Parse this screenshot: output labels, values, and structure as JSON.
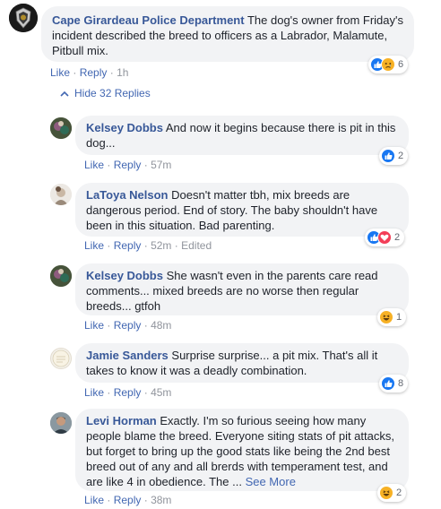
{
  "top_comment": {
    "author": "Cape Girardeau Police Department",
    "text": "The dog's owner from Friday's incident described the breed to officers as a Labrador, Malamute, Pitbull mix.",
    "like": "Like",
    "reply": "Reply",
    "time": "1h",
    "reaction_count": "6",
    "reactions": [
      "like",
      "sad"
    ]
  },
  "hide_replies": "Hide 32 Replies",
  "replies": [
    {
      "author": "Kelsey Dobbs",
      "text": "And now it begins because there is pit in this dog...",
      "like": "Like",
      "reply": "Reply",
      "time": "57m",
      "edited": "",
      "reaction_count": "2",
      "reactions": [
        "like"
      ]
    },
    {
      "author": "LaToya Nelson",
      "text": "Doesn't matter tbh, mix breeds are dangerous period. End of story. The baby shouldn't have been in this situation. Bad parenting.",
      "like": "Like",
      "reply": "Reply",
      "time": "52m",
      "edited": "Edited",
      "reaction_count": "2",
      "reactions": [
        "like",
        "love"
      ]
    },
    {
      "author": "Kelsey Dobbs",
      "text": "She wasn't even in the parents care read comments... mixed breeds are no worse then regular breeds... gtfoh",
      "like": "Like",
      "reply": "Reply",
      "time": "48m",
      "edited": "",
      "reaction_count": "1",
      "reactions": [
        "haha"
      ]
    },
    {
      "author": "Jamie Sanders",
      "text": "Surprise surprise... a pit mix. That's all it takes to know it was a deadly combination.",
      "like": "Like",
      "reply": "Reply",
      "time": "45m",
      "edited": "",
      "reaction_count": "8",
      "reactions": [
        "like"
      ]
    },
    {
      "author": "Levi Horman",
      "text": "Exactly. I'm so furious seeing how many people blame the breed. Everyone siting stats of pit attacks, but forget to bring up the good stats like being the 2nd best breed out of any and all brerds with temperament test, and are like 4 in obedience. The ...",
      "see_more": "See More",
      "like": "Like",
      "reply": "Reply",
      "time": "38m",
      "edited": "",
      "reaction_count": "2",
      "reactions": [
        "haha"
      ]
    }
  ],
  "colors": {
    "link": "#385898",
    "action": "#4267b2",
    "bubble": "#f2f3f5",
    "meta": "#90949c"
  }
}
